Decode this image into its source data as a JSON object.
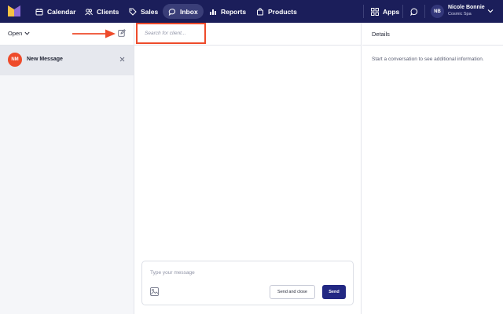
{
  "nav": {
    "items": [
      {
        "label": "Calendar",
        "icon": "calendar-icon"
      },
      {
        "label": "Clients",
        "icon": "users-icon"
      },
      {
        "label": "Sales",
        "icon": "tag-icon"
      },
      {
        "label": "Inbox",
        "icon": "chat-icon",
        "active": true
      },
      {
        "label": "Reports",
        "icon": "bar-chart-icon"
      },
      {
        "label": "Products",
        "icon": "bag-icon"
      }
    ],
    "apps_label": "Apps",
    "user": {
      "initials": "NB",
      "name": "Nicole Bonnie",
      "org": "Cosmic Spa"
    }
  },
  "left": {
    "filter_label": "Open",
    "messages": [
      {
        "initials": "NM",
        "title": "New Message"
      }
    ]
  },
  "search": {
    "placeholder": "Search for client..."
  },
  "composer": {
    "placeholder": "Type your message",
    "send_close_label": "Send and close",
    "send_label": "Send"
  },
  "details": {
    "title": "Details",
    "empty_text": "Start a conversation to see additional information."
  },
  "colors": {
    "nav_bg": "#1b1e5a",
    "accent_red": "#ee4b2b",
    "send_button": "#222883"
  }
}
